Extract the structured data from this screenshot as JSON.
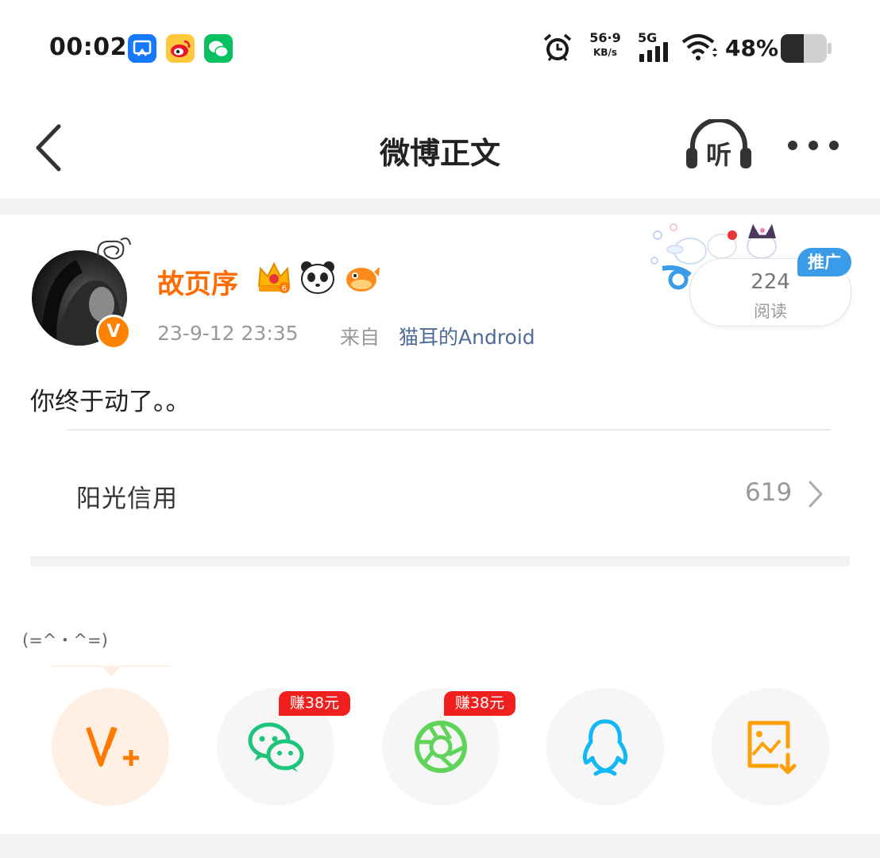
{
  "status_bar": {
    "time": "00:02",
    "net_speed_value": "56·9",
    "net_speed_unit": "KB/s",
    "network": "5G",
    "battery": "48%",
    "app_icons": [
      "screenshot-icon",
      "weibo-icon",
      "wechat-icon"
    ]
  },
  "nav": {
    "title": "微博正文",
    "listen_label": "听"
  },
  "post": {
    "username": "故页序",
    "verified": "V",
    "time": "23-9-12  23:35",
    "source_prefix": "来自",
    "source_device": "猫耳的Android",
    "read_count": "224",
    "read_label": "阅读",
    "promo_badge": "推广",
    "text": "你终于动了。。"
  },
  "credit": {
    "label": "阳光信用",
    "score": "619"
  },
  "share": {
    "kaomoji": "(=^・^=)",
    "buttons": [
      {
        "name": "vplus",
        "icon": "v-plus-icon"
      },
      {
        "name": "wechat",
        "icon": "wechat-icon",
        "badge": "赚38元"
      },
      {
        "name": "moments",
        "icon": "moments-icon",
        "badge": "赚38元"
      },
      {
        "name": "qq",
        "icon": "qq-icon"
      },
      {
        "name": "save-image",
        "icon": "save-image-icon"
      }
    ]
  },
  "colors": {
    "brand_orange": "#ff6b00",
    "link_blue": "#4f6b95",
    "promo_blue": "#3a9be8",
    "earn_red": "#f0201e",
    "wechat_green": "#1ec47a",
    "moments_green": "#5fd35a",
    "qq_blue": "#12b7f5",
    "save_orange": "#ff9f0a"
  }
}
